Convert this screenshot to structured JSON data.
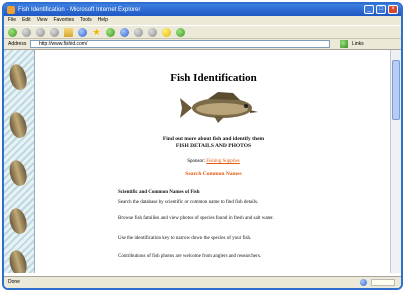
{
  "window": {
    "title": "Fish Identification - Microsoft Internet Explorer"
  },
  "menu": [
    "File",
    "Edit",
    "View",
    "Favorites",
    "Tools",
    "Help"
  ],
  "address": {
    "label": "Address",
    "url": "http://www.fishid.com/",
    "links_label": "Links"
  },
  "page": {
    "heading": "Fish Identification",
    "intro_line1": "Find out more about fish and identify them",
    "intro_line2": "FISH DETAILS AND PHOTOS",
    "sponsor_label": "Sponsor:",
    "sponsor_link": "Fishing Supplies",
    "nav_link": "Search Common Names",
    "paragraphs": [
      {
        "text": "Scientific and Common Names of Fish"
      },
      {
        "text": "Search the database by scientific or common name to find fish details."
      },
      {
        "text": "Browse fish families and view photos of species found in fresh and salt water."
      },
      {
        "text": "Use the identification key to narrow down the species of your fish."
      },
      {
        "text": "Contributions of fish photos are welcome from anglers and researchers."
      }
    ]
  },
  "status": {
    "text": "Done",
    "zone": "Internet"
  }
}
